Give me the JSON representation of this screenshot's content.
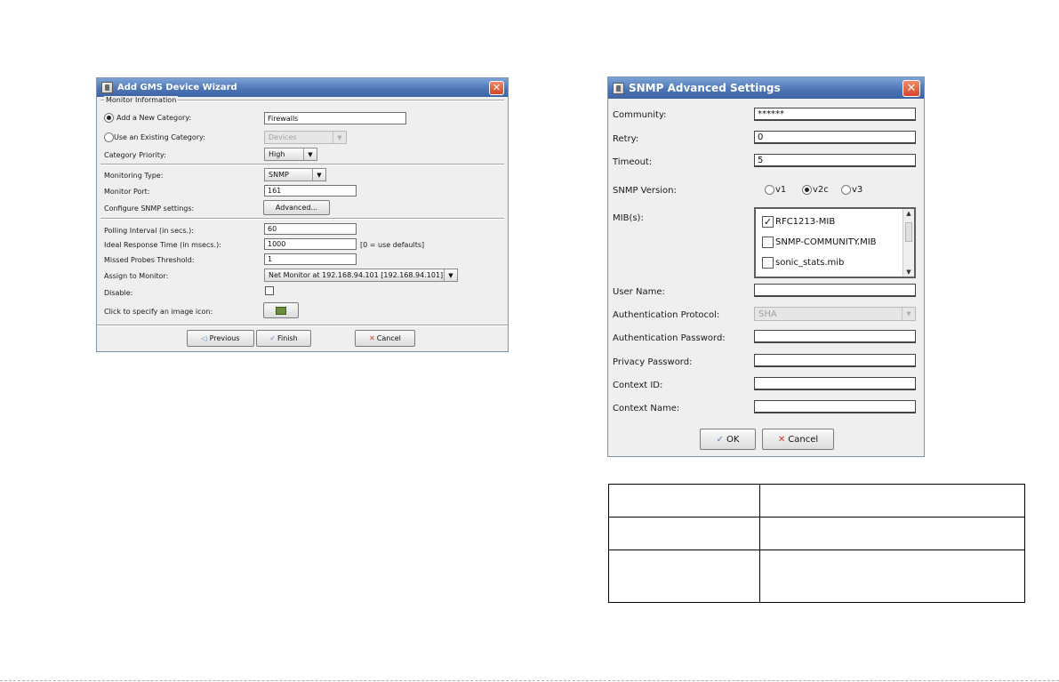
{
  "wizard": {
    "title": "Add GMS Device Wizard",
    "group_title": "Monitor Information",
    "add_new_category_label": "Add a New Category:",
    "add_new_category_value": "Firewalls",
    "use_existing_category_label": "Use an Existing Category:",
    "existing_category_value": "Devices",
    "category_priority_label": "Category Priority:",
    "category_priority_value": "High",
    "monitoring_type_label": "Monitoring Type:",
    "monitoring_type_value": "SNMP",
    "monitor_port_label": "Monitor Port:",
    "monitor_port_value": "161",
    "configure_snmp_label": "Configure SNMP settings:",
    "advanced_button": "Advanced...",
    "polling_interval_label": "Polling Interval (in secs.):",
    "polling_interval_value": "60",
    "ideal_response_label": "Ideal Response Time (in msecs.):",
    "ideal_response_value": "1000",
    "ideal_response_hint": "[0 = use defaults]",
    "missed_probes_label": "Missed Probes Threshold:",
    "missed_probes_value": "1",
    "assign_monitor_label": "Assign to Monitor:",
    "assign_monitor_value": "Net Monitor at 192.168.94.101 [192.168.94.101]",
    "disable_label": "Disable:",
    "image_icon_label": "Click to specify an image icon:",
    "previous_button": "Previous",
    "finish_button": "Finish",
    "cancel_button": "Cancel"
  },
  "snmp": {
    "title": "SNMP Advanced Settings",
    "community_label": "Community:",
    "community_value": "******",
    "retry_label": "Retry:",
    "retry_value": "0",
    "timeout_label": "Timeout:",
    "timeout_value": "5",
    "version_label": "SNMP Version:",
    "versions": [
      "v1",
      "v2c",
      "v3"
    ],
    "selected_version": "v2c",
    "mibs_label": "MIB(s):",
    "mibs": [
      {
        "name": "RFC1213-MIB",
        "checked": true
      },
      {
        "name": "SNMP-COMMUNITY.MIB",
        "checked": false
      },
      {
        "name": "sonic_stats.mib",
        "checked": false
      }
    ],
    "user_name_label": "User Name:",
    "auth_protocol_label": "Authentication Protocol:",
    "auth_protocol_value": "SHA",
    "auth_password_label": "Authentication Password:",
    "privacy_password_label": "Privacy Password:",
    "context_id_label": "Context ID:",
    "context_name_label": "Context Name:",
    "ok_button": "OK",
    "cancel_button": "Cancel"
  },
  "colors": {
    "titlebar": "#4b73b3",
    "close": "#d4462a",
    "dialog_bg": "#efefef"
  }
}
